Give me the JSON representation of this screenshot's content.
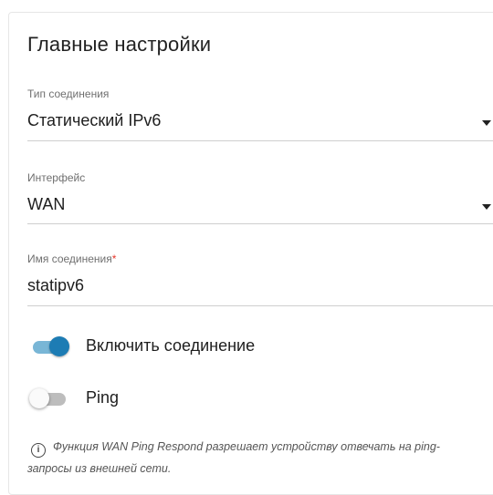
{
  "section": {
    "title": "Главные настройки"
  },
  "connection_type": {
    "label": "Тип соединения",
    "value": "Статический IPv6"
  },
  "interface": {
    "label": "Интерфейс",
    "value": "WAN"
  },
  "connection_name": {
    "label": "Имя соединения",
    "required_mark": "*",
    "value": "statipv6"
  },
  "toggles": {
    "enable_connection": {
      "label": "Включить соединение",
      "state": "on"
    },
    "ping": {
      "label": "Ping",
      "state": "off"
    }
  },
  "info": {
    "icon": "i",
    "text": "Функция WAN Ping Respond разрешает устройству отвечать на ping-запросы из внешней сети."
  },
  "colors": {
    "accent": "#1d7cb4",
    "accent_track": "#79b6d6",
    "required": "#e5362a"
  }
}
